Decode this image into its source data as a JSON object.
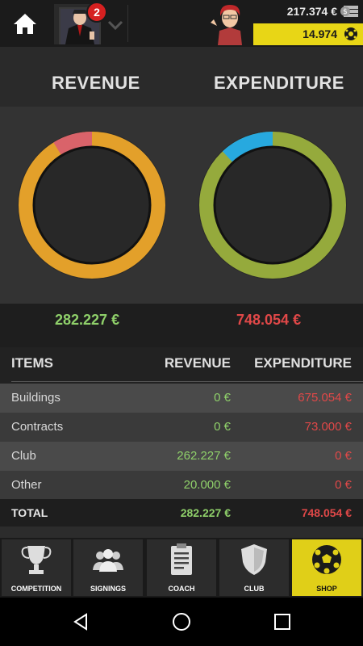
{
  "top": {
    "notification_count": "2",
    "money": "217.374 €",
    "coins": "14.974"
  },
  "summary": {
    "revenue_title": "REVENUE",
    "expenditure_title": "EXPENDITURE",
    "revenue_total": "282.227 €",
    "expenditure_total": "748.054 €"
  },
  "table": {
    "headers": {
      "items": "ITEMS",
      "revenue": "REVENUE",
      "expenditure": "EXPENDITURE"
    },
    "rows": [
      {
        "item": "Buildings",
        "revenue": "0 €",
        "expenditure": "675.054 €"
      },
      {
        "item": "Contracts",
        "revenue": "0 €",
        "expenditure": "73.000 €"
      },
      {
        "item": "Club",
        "revenue": "262.227 €",
        "expenditure": "0 €"
      },
      {
        "item": "Other",
        "revenue": "20.000 €",
        "expenditure": "0 €"
      }
    ],
    "total": {
      "item": "TOTAL",
      "revenue": "282.227 €",
      "expenditure": "748.054 €"
    }
  },
  "nav": [
    {
      "label": "COMPETITION",
      "icon": "trophy-icon"
    },
    {
      "label": "SIGNINGS",
      "icon": "people-icon"
    },
    {
      "label": "COACH",
      "icon": "clipboard-icon"
    },
    {
      "label": "CLUB",
      "icon": "shield-icon"
    },
    {
      "label": "SHOP",
      "icon": "soccer-ball-icon"
    }
  ],
  "colors": {
    "revenue_ring": "#e3a02a",
    "revenue_segment": "#d9636a",
    "expenditure_ring": "#95aa3c",
    "expenditure_segment": "#27a9df",
    "revenue_text": "#8fd06a",
    "expenditure_text": "#e04848",
    "shop_active": "#e0cf18"
  }
}
